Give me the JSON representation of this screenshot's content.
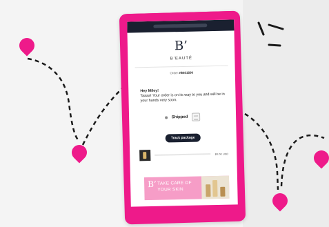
{
  "app": {
    "logo": "B’",
    "brand": "B’EAUTÉ"
  },
  "order": {
    "prefix": "Order ",
    "number": "#B401500"
  },
  "message": {
    "greeting": "Hey Miley!",
    "body": "Taaaa! Your order is on its way to you and will be in your hands very soon."
  },
  "status": {
    "label": "Shipped"
  },
  "actions": {
    "track_label": "Track package"
  },
  "product": {
    "price": "$0.00 USD"
  },
  "banner": {
    "logo": "B’",
    "line1": "TAKE CARE OF",
    "line2": "YOUR SKIN"
  },
  "colors": {
    "accent": "#ee1a8a",
    "dark": "#1a2030",
    "banner": "#f69dc7"
  },
  "icons": {
    "pin": "location-pin-icon",
    "package": "package-icon"
  }
}
